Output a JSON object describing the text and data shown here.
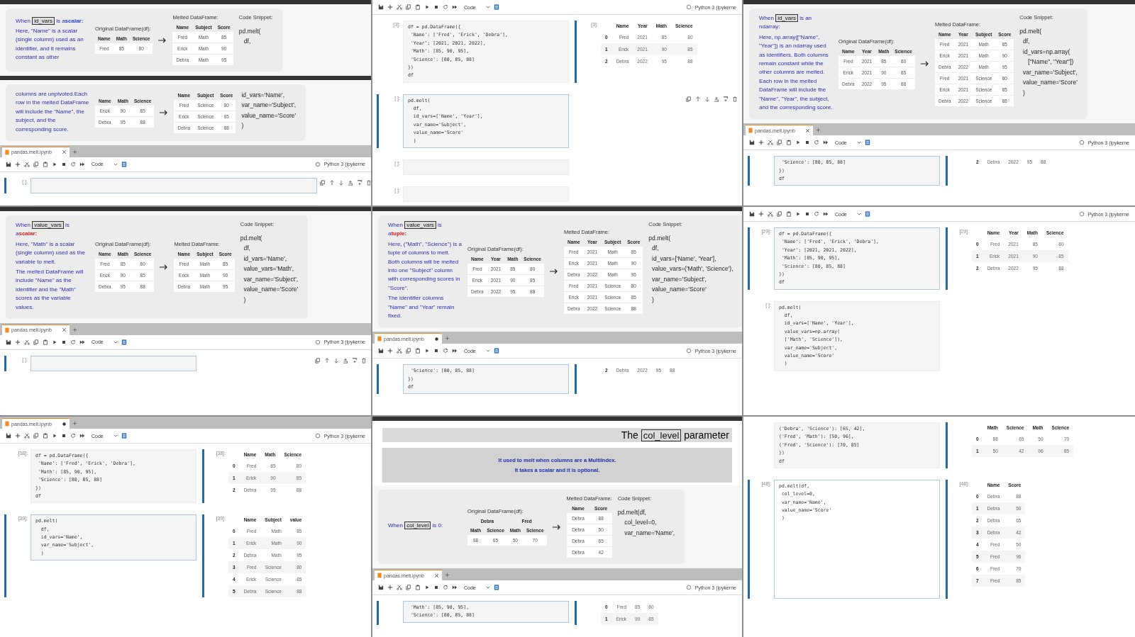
{
  "panels": [
    {
      "parts": [
        {
          "kind": "divider"
        },
        {
          "kind": "slide",
          "desc": {
            "before": "When",
            "term": "id_vars",
            "after": "is a",
            "emphasis": "scalar:",
            "color": "#1f3fd0",
            "body": [
              "Here, \"Name\" is a scalar (single column) used as an identifier, and it remains constant as other"
            ]
          },
          "original": {
            "caption": "Original DataFrame(df):",
            "columns": [
              "Name",
              "Math",
              "Science"
            ],
            "rows": [
              [
                "Fred",
                "85",
                "80"
              ]
            ]
          },
          "melted": {
            "caption": "Melted DataFrame:",
            "columns": [
              "Name",
              "Subject",
              "Score"
            ],
            "rows": [
              [
                "Fred",
                "Math",
                "85"
              ],
              [
                "Erick",
                "Math",
                "90"
              ],
              [
                "Debra",
                "Math",
                "95"
              ]
            ]
          },
          "snippet": {
            "caption": "Code Snippet:",
            "lines": [
              "pd.melt(",
              "   df,"
            ]
          }
        },
        {
          "kind": "divider"
        },
        {
          "kind": "slide",
          "desc": {
            "body": [
              "columns are unpivoted.Each row in the melted DataFrame will include the \"Name\", the subject, and the corresponding score."
            ]
          },
          "original": {
            "columns": [
              "Name",
              "Math",
              "Science"
            ],
            "rows": [
              [
                "Erick",
                "90",
                "85"
              ],
              [
                "Debra",
                "95",
                "88"
              ]
            ]
          },
          "melted": {
            "columns": [
              "Name",
              "Subject",
              "Score"
            ],
            "rows": [
              [
                "Fred",
                "Science",
                "80"
              ],
              [
                "Erick",
                "Science",
                "85"
              ],
              [
                "Debra",
                "Science",
                "88"
              ]
            ]
          },
          "snippet": {
            "lines": [
              "id_vars='Name',",
              "var_name='Subject',",
              "value_name='Score'",
              ")"
            ]
          }
        },
        {
          "kind": "tabbar",
          "tab": {
            "title": "pandas.melt.ipynb",
            "modified": false
          },
          "cell_type": "Code",
          "kernel": "Python 3 (ipykerne"
        },
        {
          "kind": "cell",
          "prompt": "[ ]:",
          "active": true,
          "actions": true
        }
      ]
    },
    {
      "parts": [
        {
          "kind": "toolbar",
          "cell_type": "Code",
          "kernel": "Python 3 (ipykerne"
        },
        {
          "kind": "cell",
          "prompt": "[3]:",
          "active": false,
          "code": [
            "df = pd.DataFrame({",
            " 'Name': ['Fred', 'Erick', 'Debra'],",
            " 'Year': [2021, 2021, 2022],",
            " 'Math': [85, 90, 95],",
            " 'Science': [80, 85, 88]",
            "})",
            "df"
          ],
          "output": {
            "prompt": "[3]:",
            "columns": [
              "",
              "Name",
              "Year",
              "Math",
              "Science"
            ],
            "rows": [
              [
                "0",
                "Fred",
                "2021",
                "85",
                "80"
              ],
              [
                "1",
                "Erick",
                "2021",
                "90",
                "85"
              ],
              [
                "2",
                "Debra",
                "2022",
                "95",
                "88"
              ]
            ]
          }
        },
        {
          "kind": "cell",
          "prompt": "[ ]:",
          "active": true,
          "actions": true,
          "code": [
            "pd.melt(",
            "  df,",
            "  id_vars=['Name', 'Year'],",
            "  var_name='Subject',",
            "  value_name='Score'",
            "  )"
          ]
        },
        {
          "kind": "cell",
          "prompt": "[ ]:",
          "active": false
        },
        {
          "kind": "cell",
          "prompt": "[ ]:",
          "active": false
        }
      ]
    },
    {
      "parts": [
        {
          "kind": "divider"
        },
        {
          "kind": "slide",
          "desc": {
            "before": "When",
            "term": "id_vars",
            "after": "is an ndarray:",
            "body": [
              "Here, np.array([\"Name\", \"Year\"]) is an ndarray used as identifiers. Both columns remain constant while the other columns are melted. Each row in the melted DataFrame will include the \"Name\", \"Year\", the subject, and the corresponding score."
            ]
          },
          "original": {
            "caption": "Original DataFrame(df):",
            "columns": [
              "Name",
              "Year",
              "Math",
              "Science"
            ],
            "rows": [
              [
                "Fred",
                "2021",
                "85",
                "80"
              ],
              [
                "Erick",
                "2021",
                "90",
                "85"
              ],
              [
                "Debra",
                "2022",
                "95",
                "88"
              ]
            ]
          },
          "melted": {
            "caption": "Melted DataFrame:",
            "columns": [
              "Name",
              "Year",
              "Subject",
              "Score"
            ],
            "rows": [
              [
                "Fred",
                "2021",
                "Math",
                "85"
              ],
              [
                "Erick",
                "2021",
                "Math",
                "90"
              ],
              [
                "Debra",
                "2022",
                "Math",
                "95"
              ],
              [
                "Fred",
                "2021",
                "Science",
                "80"
              ],
              [
                "Erick",
                "2021",
                "Science",
                "85"
              ],
              [
                "Debra",
                "2022",
                "Science",
                "88"
              ]
            ]
          },
          "snippet": {
            "caption": "Code Snippet:",
            "lines": [
              "pd.melt(",
              "  df,",
              "  id_vars=np.array(",
              "     [\"Name\", \"Year\"])",
              "  var_name='Subject',",
              "  value_name='Score'",
              "  )"
            ]
          }
        },
        {
          "kind": "tabbar",
          "tab": {
            "title": "pandas.melt.ipynb",
            "modified": false
          },
          "cell_type": "Code",
          "kernel": "Python 3 (ipykerne"
        },
        {
          "kind": "cell",
          "active": true,
          "code": [
            " 'Science': [80, 85, 88]",
            "})",
            "df"
          ],
          "output": {
            "rows": [
              [
                "2",
                "Debra",
                "2022",
                "95",
                "88"
              ]
            ]
          }
        }
      ]
    },
    {
      "parts": [
        {
          "kind": "divider"
        },
        {
          "kind": "slide",
          "desc": {
            "before": "When",
            "term": "value_vars",
            "after": "is a",
            "emphasis": "scalar:",
            "color": "#d42020",
            "body": [
              "Here, \"Math\" is a scalar (single column) used as the variable to melt.",
              "The melted DataFrame will include \"Name\" as the identifier and the \"Math\" scores as the variable values."
            ]
          },
          "original": {
            "caption": "Original DataFrame(df):",
            "columns": [
              "Name",
              "Math",
              "Science"
            ],
            "rows": [
              [
                "Fred",
                "85",
                "80"
              ],
              [
                "Erick",
                "90",
                "85"
              ],
              [
                "Debra",
                "95",
                "88"
              ]
            ]
          },
          "melted": {
            "caption": "Melted DataFrame:",
            "columns": [
              "Name",
              "Subject",
              "Score"
            ],
            "rows": [
              [
                "Fred",
                "Math",
                "85"
              ],
              [
                "Erick",
                "Math",
                "90"
              ],
              [
                "Debra",
                "Math",
                "95"
              ]
            ]
          },
          "snippet": {
            "caption": "Code Snippet:",
            "lines": [
              "pd.melt(",
              "  df,",
              "  id_vars='Name',",
              "  value_vars='Math',",
              "  var_name='Subject',",
              "  value_name='Score'",
              "  )"
            ]
          }
        },
        {
          "kind": "tabbar",
          "tab": {
            "title": "pandas.melt.ipynb",
            "modified": false
          },
          "cell_type": "Code",
          "kernel": "Python 3 (ipykerne"
        },
        {
          "kind": "cell",
          "prompt": "[ ]:",
          "active": true,
          "actions": true
        }
      ]
    },
    {
      "parts": [
        {
          "kind": "divider"
        },
        {
          "kind": "slide",
          "desc": {
            "before": "When",
            "term": "value_vars",
            "after": "is a",
            "emphasis": "tuple:",
            "color": "#d42020",
            "body": [
              "Here, (\"Math\", \"Science\") is a tuple of columns to melt. Both columns will be melted into one \"Subject\" column with corresponding scores in \"Score\".",
              "The identifier columns \"Name\" and \"Year\" remain fixed."
            ]
          },
          "original": {
            "caption": "Original DataFrame(df):",
            "columns": [
              "Name",
              "Year",
              "Math",
              "Science"
            ],
            "rows": [
              [
                "Fred",
                "2021",
                "85",
                "80"
              ],
              [
                "Erick",
                "2021",
                "90",
                "85"
              ],
              [
                "Debra",
                "2022",
                "95",
                "88"
              ]
            ]
          },
          "melted": {
            "caption": "Melted DataFrame:",
            "columns": [
              "Name",
              "Year",
              "Subject",
              "Score"
            ],
            "rows": [
              [
                "Fred",
                "2021",
                "Math",
                "85"
              ],
              [
                "Erick",
                "2021",
                "Math",
                "90"
              ],
              [
                "Debra",
                "2022",
                "Math",
                "95"
              ],
              [
                "Fred",
                "2021",
                "Science",
                "80"
              ],
              [
                "Erick",
                "2021",
                "Science",
                "85"
              ],
              [
                "Debra",
                "2022",
                "Science",
                "88"
              ]
            ]
          },
          "snippet": {
            "caption": "Code Snippet:",
            "lines": [
              "pd.melt(",
              "  df,",
              "  id_vars=['Name', 'Year'],",
              "  value_vars=('Math', 'Science'),",
              "  var_name='Subject',",
              "  value_name='Score'",
              "  )"
            ]
          }
        },
        {
          "kind": "tabbar",
          "tab": {
            "title": "pandas.melt.ipynb",
            "modified": true
          },
          "cell_type": "Code",
          "kernel": "Python 3 (ipykerne"
        },
        {
          "kind": "cell",
          "active": true,
          "code": [
            " 'Science': [80, 85, 88]",
            "})",
            "df"
          ],
          "output": {
            "rows": [
              [
                "2",
                "Debra",
                "2022",
                "95",
                "88"
              ]
            ]
          }
        }
      ]
    },
    {
      "parts": [
        {
          "kind": "toolbar",
          "cell_type": "Code",
          "kernel": "Python 3 (ipykerne"
        },
        {
          "kind": "cell",
          "prompt": "[29]:",
          "active": true,
          "code": [
            "df = pd.DataFrame({",
            " 'Name': ['Fred', 'Erick', 'Debra'],",
            " 'Year': [2021, 2021, 2022],",
            " 'Math': [85, 90, 95],",
            " 'Science': [80, 85, 88]",
            "})",
            "df"
          ],
          "output": {
            "prompt": "[29]:",
            "columns": [
              "",
              "Name",
              "Year",
              "Math",
              "Science"
            ],
            "rows": [
              [
                "0",
                "Fred",
                "2021",
                "85",
                "80"
              ],
              [
                "1",
                "Erick",
                "2021",
                "90",
                "85"
              ],
              [
                "2",
                "Debra",
                "2022",
                "95",
                "88"
              ]
            ]
          }
        },
        {
          "kind": "cell",
          "prompt": "[ ]:",
          "active": false,
          "code": [
            "pd.melt(",
            "  df,",
            "  id_vars=['Name', 'Year'],",
            "  value_vars=np.array(",
            "  ['Math', 'Science']),",
            "  var_name='Subject',",
            "  value_name='Score'",
            "  )"
          ]
        }
      ]
    },
    {
      "parts": [
        {
          "kind": "tabbar",
          "tab": {
            "title": "pandas.melt.ipynb",
            "modified": true
          },
          "cell_type": "Code",
          "kernel": "Python 3 (ipykerne"
        },
        {
          "kind": "cell",
          "prompt": "[38]:",
          "active": false,
          "code": [
            "df = pd.DataFrame({",
            " 'Name': ['Fred', 'Erick', 'Debra'],",
            " 'Math': [85, 90, 95],",
            " 'Science': [80, 85, 88]",
            "})",
            "df"
          ],
          "output": {
            "prompt": "[38]:",
            "columns": [
              "",
              "Name",
              "Math",
              "Science"
            ],
            "rows": [
              [
                "0",
                "Fred",
                "85",
                "80"
              ],
              [
                "1",
                "Erick",
                "90",
                "85"
              ],
              [
                "2",
                "Debra",
                "95",
                "88"
              ]
            ]
          }
        },
        {
          "kind": "cell",
          "prompt": "[39]:",
          "active": true,
          "code": [
            "pd.melt(",
            "  df,",
            "  id_vars='Name',",
            "  var_name='Subject',",
            "  )"
          ],
          "output": {
            "prompt": "[39]:",
            "columns": [
              "",
              "Name",
              "Subject",
              "value"
            ],
            "rows": [
              [
                "0",
                "Fred",
                "Math",
                "85"
              ],
              [
                "1",
                "Erick",
                "Math",
                "90"
              ],
              [
                "2",
                "Debra",
                "Math",
                "95"
              ],
              [
                "3",
                "Fred",
                "Science",
                "80"
              ],
              [
                "4",
                "Erick",
                "Science",
                "85"
              ],
              [
                "5",
                "Debra",
                "Science",
                "88"
              ]
            ]
          }
        }
      ]
    },
    {
      "parts": [
        {
          "kind": "divider"
        },
        {
          "kind": "heading",
          "before": "The",
          "term": "col_level",
          "after": "parameter"
        },
        {
          "kind": "info",
          "lines": [
            "It used to melt when columns are a MultiIndex.",
            "It takes a scalar and it is optional."
          ]
        },
        {
          "kind": "slide",
          "desc": {
            "before": "When",
            "term": "col_level",
            "after": "is 0:"
          },
          "original": {
            "caption": "Original DataFrame(df):",
            "groups": [
              "Debra",
              "Fred"
            ],
            "columns": [
              "Math",
              "Science",
              "Math",
              "Science"
            ],
            "rows": [
              [
                "88",
                "65",
                "50",
                "70"
              ]
            ]
          },
          "melted": {
            "caption": "Melted DataFrame:",
            "columns": [
              "Name",
              "Score"
            ],
            "rows": [
              [
                "Debra",
                "88"
              ],
              [
                "Debra",
                "50"
              ],
              [
                "Debra",
                "65"
              ],
              [
                "Debra",
                "42"
              ]
            ]
          },
          "snippet": {
            "caption": "Code Snippet:",
            "lines": [
              "pd.melt(df,",
              "    col_level=0,",
              "    var_name='Name',"
            ]
          }
        },
        {
          "kind": "tabbar",
          "tab": {
            "title": "pandas.melt.ipynb",
            "modified": false
          },
          "cell_type": "Code",
          "kernel": "Python 3 (ipykerne"
        },
        {
          "kind": "cell",
          "active": true,
          "code": [
            " 'Math': [85, 90, 95],",
            " 'Science': [80, 85, 88]"
          ],
          "output": {
            "rows": [
              [
                "0",
                "Fred",
                "85",
                "80"
              ],
              [
                "1",
                "Erick",
                "90",
                "85"
              ]
            ]
          }
        }
      ]
    },
    {
      "parts": [
        {
          "kind": "cell",
          "active": false,
          "code": [
            "('Debra', 'Science'): [65, 42],",
            "('Fred', 'Math'): [50, 96],",
            "('Fred', 'Science'): [70, 85]",
            "})",
            "df"
          ],
          "output": {
            "columns": [
              "",
              "Math",
              "Science",
              "Math",
              "Science"
            ],
            "rows": [
              [
                "0",
                "88",
                "65",
                "50",
                "70"
              ],
              [
                "1",
                "50",
                "42",
                "96",
                "85"
              ]
            ]
          }
        },
        {
          "kind": "cell",
          "prompt": "[48]:",
          "active": true,
          "code": [
            "pd.melt(df,",
            " col_level=0,",
            " var_name='Name',",
            " value_name='Score'",
            " )"
          ],
          "output": {
            "prompt": "[48]:",
            "columns": [
              "",
              "Name",
              "Score"
            ],
            "rows": [
              [
                "0",
                "Debra",
                "88"
              ],
              [
                "1",
                "Debra",
                "50"
              ],
              [
                "2",
                "Debra",
                "65"
              ],
              [
                "3",
                "Debra",
                "42"
              ],
              [
                "4",
                "Fred",
                "50"
              ],
              [
                "5",
                "Fred",
                "96"
              ],
              [
                "6",
                "Fred",
                "70"
              ],
              [
                "7",
                "Fred",
                "85"
              ]
            ]
          }
        }
      ]
    }
  ]
}
